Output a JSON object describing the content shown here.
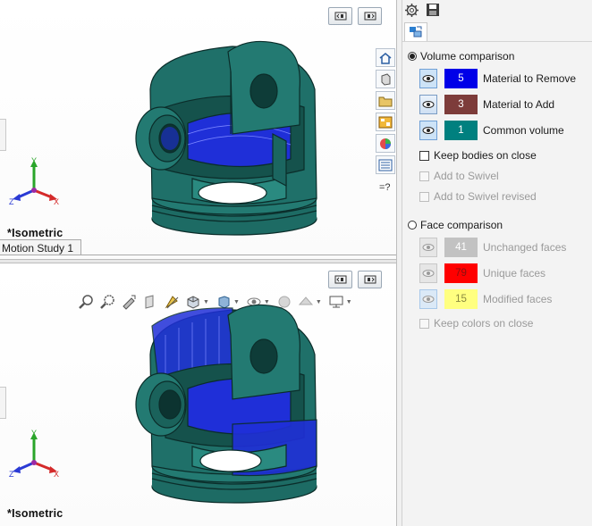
{
  "views": {
    "top": {
      "label": "*Isometric"
    },
    "bottom": {
      "label": "*Isometric"
    },
    "motion_tab": "Motion Study 1"
  },
  "triad": {
    "x": "X",
    "y": "Y",
    "z": "Z"
  },
  "right_toolbar": [
    "home-icon",
    "parts-icon",
    "folder-icon",
    "view-palette-icon",
    "appearance-icon",
    "custom-properties-icon",
    "help-toggle-icon"
  ],
  "heads_up_toolbar": [
    "zoom-to-fit-icon",
    "zoom-area-icon",
    "previous-view-icon",
    "section-view-icon",
    "dynamic-annotation-icon",
    "view-orientation-icon",
    "display-style-icon",
    "hide-show-icon",
    "edit-appearance-icon",
    "apply-scene-icon",
    "view-settings-icon"
  ],
  "panel": {
    "volume": {
      "label": "Volume comparison",
      "selected": true,
      "items": [
        {
          "count": "5",
          "label": "Material to Remove",
          "color": "#0000e8",
          "text_color": "#ffffff"
        },
        {
          "count": "3",
          "label": "Material to Add",
          "color": "#7d3c3a",
          "text_color": "#ffffff"
        },
        {
          "count": "1",
          "label": "Common volume",
          "color": "#00807f",
          "text_color": "#ffffff"
        }
      ],
      "keep_bodies": "Keep bodies on close",
      "add_swivel": "Add to Swivel",
      "add_swivel_revised": "Add to Swivel revised"
    },
    "face": {
      "label": "Face comparison",
      "selected": false,
      "items": [
        {
          "count": "41",
          "label": "Unchanged faces",
          "color": "#c2c2c2",
          "text_color": "#ffffff"
        },
        {
          "count": "79",
          "label": "Unique faces",
          "color": "#ff0000",
          "text_color": "#8a1010"
        },
        {
          "count": "15",
          "label": "Modified faces",
          "color": "#ffff80",
          "text_color": "#8a8a40"
        }
      ],
      "keep_colors": "Keep colors on close"
    }
  },
  "colors": {
    "part_teal": "#1e6a63",
    "diff_blue": "#1f2fd8"
  }
}
